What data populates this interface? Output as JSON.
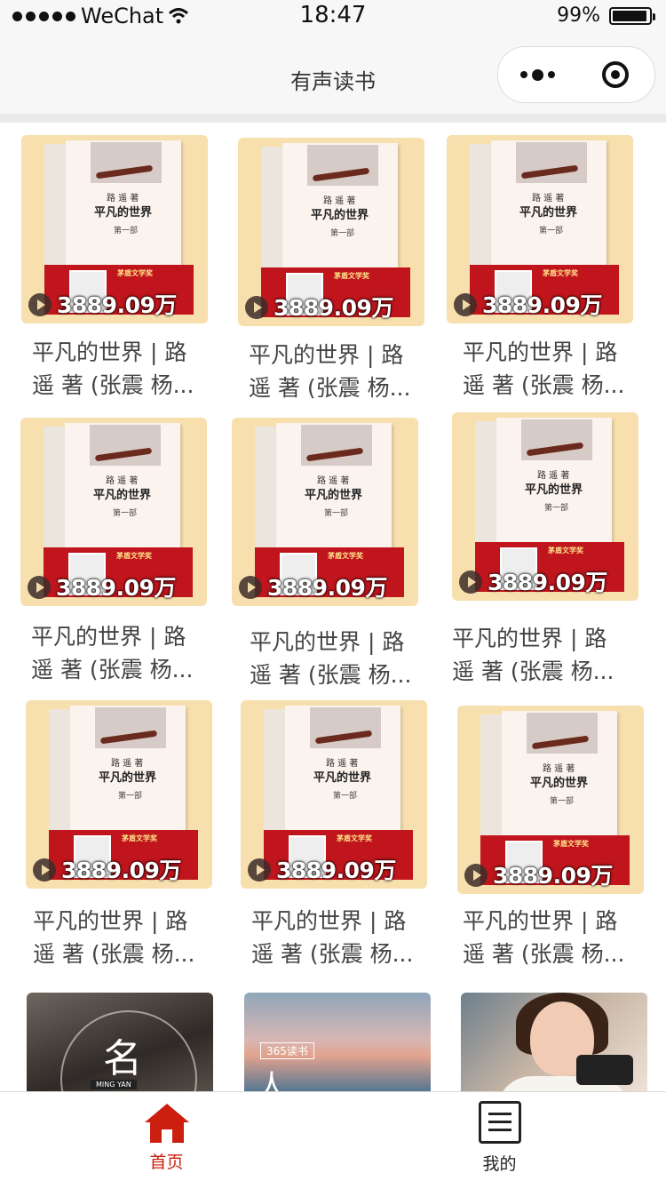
{
  "status_bar": {
    "carrier": "WeChat",
    "time": "18:47",
    "battery": "99%"
  },
  "nav": {
    "title": "有声读书"
  },
  "books": [
    {
      "title_line1": "平凡的世界 | 路",
      "title_line2": "遥 著 (张震 杨...",
      "plays": "3889.09万",
      "author": "路 遥 著",
      "cover_title": "平凡的世界",
      "volume": "第一部",
      "award": "茅盾文学奖"
    },
    {
      "title_line1": "平凡的世界 | 路",
      "title_line2": "遥 著 (张震 杨...",
      "plays": "3889.09万",
      "author": "路 遥 著",
      "cover_title": "平凡的世界",
      "volume": "第一部",
      "award": "茅盾文学奖"
    },
    {
      "title_line1": "平凡的世界 | 路",
      "title_line2": "遥 著 (张震 杨...",
      "plays": "3889.09万",
      "author": "路 遥 著",
      "cover_title": "平凡的世界",
      "volume": "第一部",
      "award": "茅盾文学奖"
    },
    {
      "title_line1": "平凡的世界 | 路",
      "title_line2": "遥 著 (张震 杨...",
      "plays": "3889.09万",
      "author": "路 遥 著",
      "cover_title": "平凡的世界",
      "volume": "第一部",
      "award": "茅盾文学奖"
    },
    {
      "title_line1": "平凡的世界 | 路",
      "title_line2": "遥 著 (张震 杨...",
      "plays": "3889.09万",
      "author": "路 遥 著",
      "cover_title": "平凡的世界",
      "volume": "第一部",
      "award": "茅盾文学奖"
    },
    {
      "title_line1": "平凡的世界 | 路",
      "title_line2": "遥 著 (张震 杨...",
      "plays": "3889.09万",
      "author": "路 遥 著",
      "cover_title": "平凡的世界",
      "volume": "第一部",
      "award": "茅盾文学奖"
    },
    {
      "title_line1": "平凡的世界 | 路",
      "title_line2": "遥 著 (张震 杨...",
      "plays": "3889.09万",
      "author": "路 遥 著",
      "cover_title": "平凡的世界",
      "volume": "第一部",
      "award": "茅盾文学奖"
    },
    {
      "title_line1": "平凡的世界 | 路",
      "title_line2": "遥 著 (张震 杨...",
      "plays": "3889.09万",
      "author": "路 遥 著",
      "cover_title": "平凡的世界",
      "volume": "第一部",
      "award": "茅盾文学奖"
    },
    {
      "title_line1": "平凡的世界 | 路",
      "title_line2": "遥 著 (张震 杨...",
      "plays": "3889.09万",
      "author": "路 遥 著",
      "cover_title": "平凡的世界",
      "volume": "第一部",
      "award": "茅盾文学奖"
    }
  ],
  "partial_row": [
    {
      "cover_text": "名",
      "cover_sub": "MING YAN"
    },
    {
      "cover_tag": "365读书",
      "cover_text": "人"
    },
    {
      "cover_text": ""
    }
  ],
  "tabbar": {
    "home_label": "首页",
    "mine_label": "我的",
    "active_color": "#cc1f10",
    "home_icon": "house-icon",
    "mine_icon": "list-icon"
  }
}
